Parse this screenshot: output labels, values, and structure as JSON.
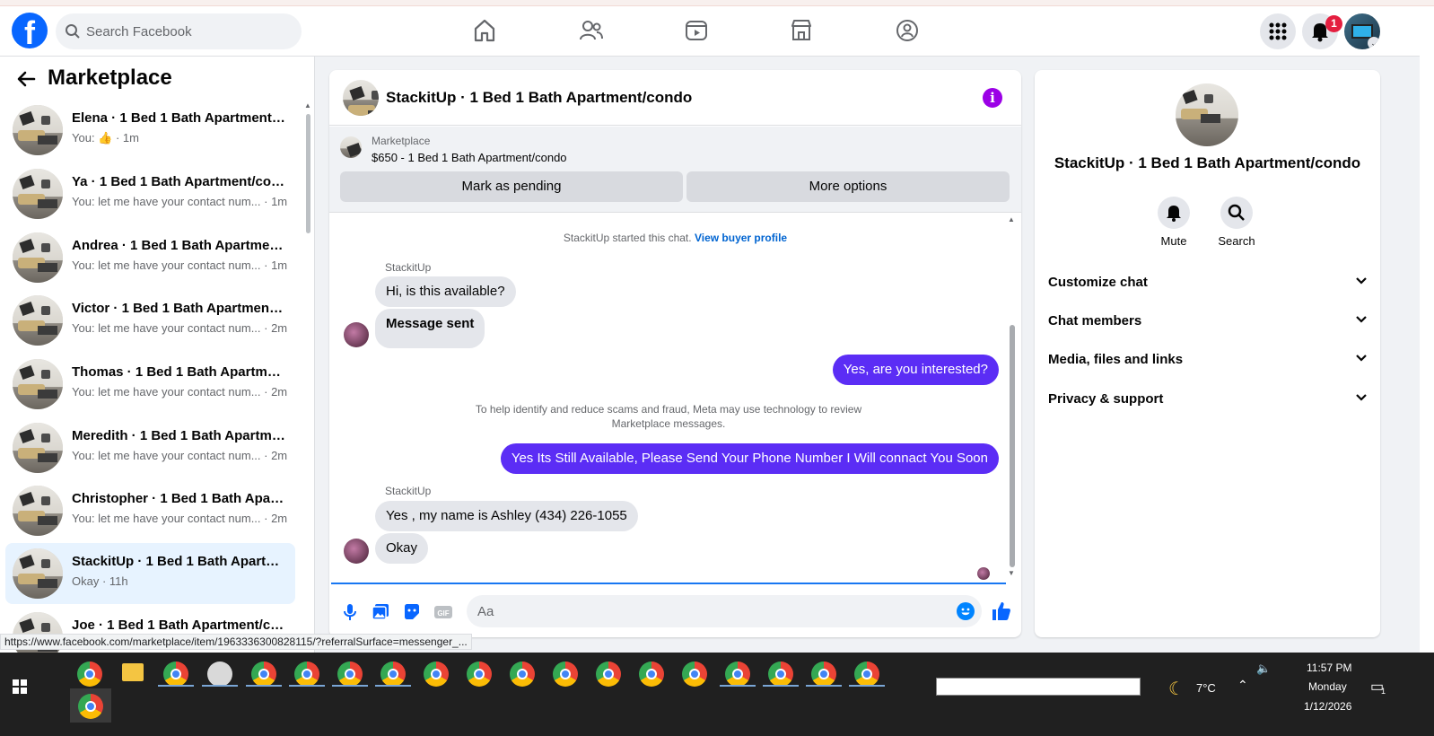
{
  "header": {
    "search_placeholder": "Search Facebook",
    "notification_count": "1",
    "nav_icons": [
      "home-icon",
      "friends-icon",
      "video-icon",
      "marketplace-icon",
      "groups-icon"
    ],
    "brand_color": "#0866ff"
  },
  "sidebar": {
    "title": "Marketplace",
    "conversations": [
      {
        "name": "Elena · 1 Bed 1 Bath Apartment/condo",
        "snippet": "You: 👍 · 1m"
      },
      {
        "name": "Ya · 1 Bed 1 Bath Apartment/condo",
        "snippet": "You: let me have your contact num... · 1m"
      },
      {
        "name": "Andrea · 1 Bed 1 Bath Apartment/condo",
        "snippet": "You: let me have your contact num... · 1m"
      },
      {
        "name": "Victor · 1 Bed 1 Bath Apartment/condo",
        "snippet": "You: let me have your contact num... · 2m"
      },
      {
        "name": "Thomas · 1 Bed 1 Bath Apartment/condo",
        "snippet": "You: let me have your contact num... · 2m"
      },
      {
        "name": "Meredith · 1 Bed 1 Bath Apartment/condo",
        "snippet": "You: let me have your contact num... · 2m"
      },
      {
        "name": "Christopher · 1 Bed 1 Bath Apartment/condo",
        "snippet": "You: let me have your contact num... · 2m"
      },
      {
        "name": "StackitUp · 1 Bed 1 Bath Apartment/condo",
        "snippet": "Okay · 11h"
      },
      {
        "name": "Joe · 1 Bed 1 Bath Apartment/condo",
        "snippet": ""
      }
    ]
  },
  "chat": {
    "title": "StackitUp · 1 Bed 1 Bath Apartment/condo",
    "listing_source": "Marketplace",
    "listing_price": "$650 - 1 Bed 1 Bath Apartment/condo",
    "mark_pending_label": "Mark as pending",
    "more_options_label": "More options",
    "started_text": "StackitUp started this chat.",
    "view_profile_label": "View buyer profile",
    "sender_name": "StackitUp",
    "msg1": "Hi, is this available?",
    "msg2": "Message sent",
    "msg3": "Yes, are you interested?",
    "scam_notice": "To help identify and reduce scams and fraud, Meta may use technology to review Marketplace messages.",
    "msg4": "Yes Its Still Available, Please Send Your Phone Number I Will connact You Soon",
    "msg5": "Yes , my name is Ashley (434) 226-1055",
    "msg6": "Okay",
    "composer_placeholder": "Aa",
    "outgoing_color": "#5b2df5"
  },
  "info_panel": {
    "name": "StackitUp · 1 Bed 1 Bath Apartment/condo",
    "mute_label": "Mute",
    "search_label": "Search",
    "sections": [
      "Customize chat",
      "Chat members",
      "Media, files and links",
      "Privacy & support"
    ]
  },
  "status_link": "https://www.facebook.com/marketplace/item/1963336300828115/?referralSurface=messenger_...",
  "taskbar": {
    "weather": "7°C",
    "time": "11:57 PM",
    "day": "Monday",
    "date": "1/12/2026",
    "notification_count": "1"
  }
}
